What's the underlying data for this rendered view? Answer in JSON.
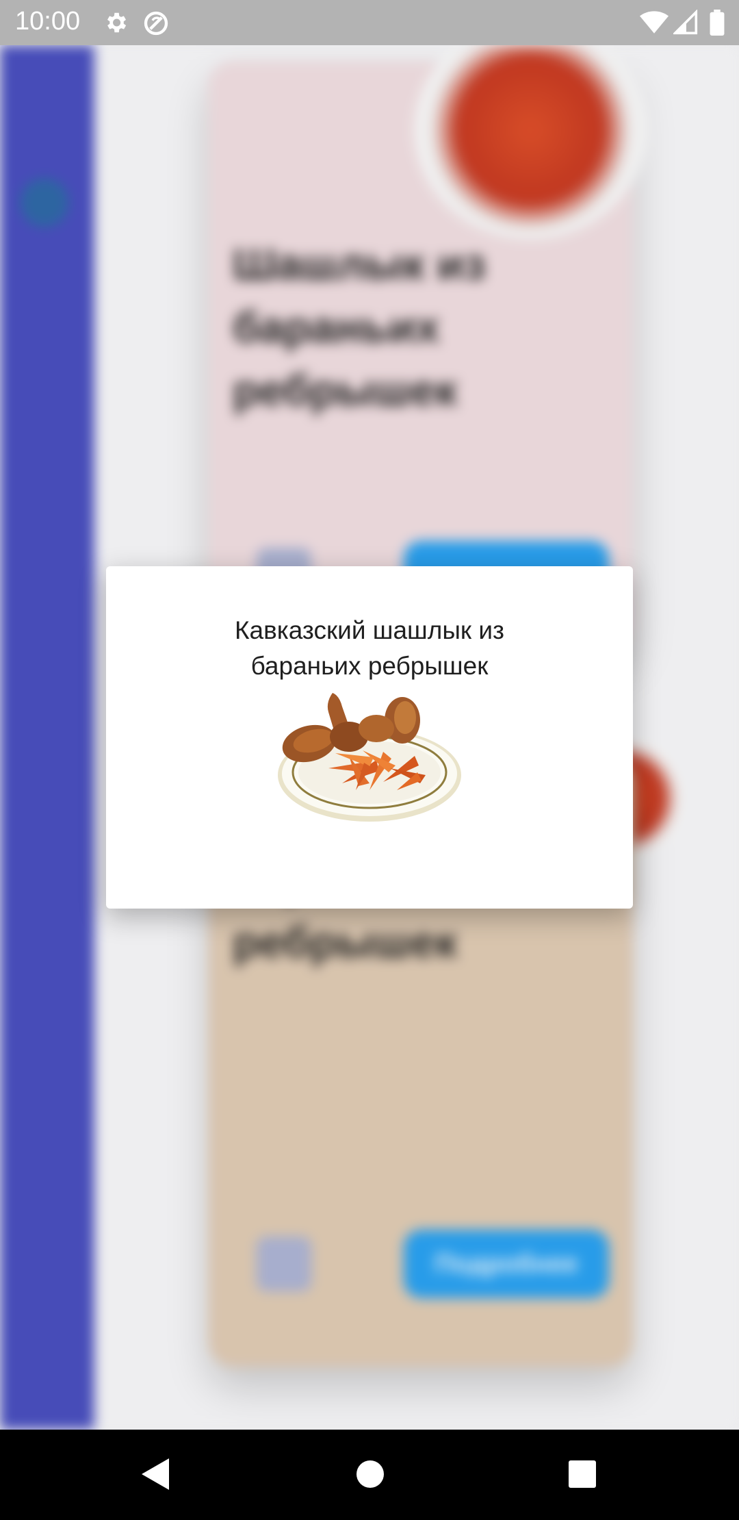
{
  "status_bar": {
    "time": "10:00",
    "icons": [
      "gear-icon",
      "sync-off-icon",
      "wifi-icon",
      "signal-icon",
      "battery-icon"
    ]
  },
  "background_app": {
    "rail": {
      "buttons": [
        "",
        "",
        ""
      ],
      "categories": [
        "",
        "",
        "",
        ""
      ]
    },
    "cards": [
      {
        "title": "Шашлык из бараньих ребрышек"
      },
      {
        "title": "Шашлык из бараньих ребрышек",
        "button": "Подробнее"
      }
    ]
  },
  "dialog": {
    "title": "Кавказский шашлык из бараньих ребрышек",
    "image": "grilled-chicken-with-potato-wedges"
  },
  "navigation_bar": {
    "buttons": [
      "back",
      "home",
      "recents"
    ]
  },
  "colors": {
    "rail": "#4a50c0",
    "accent_button": "#2aa3f3",
    "card_pink": "#f2dfe2",
    "card_tan": "#e1ccb5"
  }
}
